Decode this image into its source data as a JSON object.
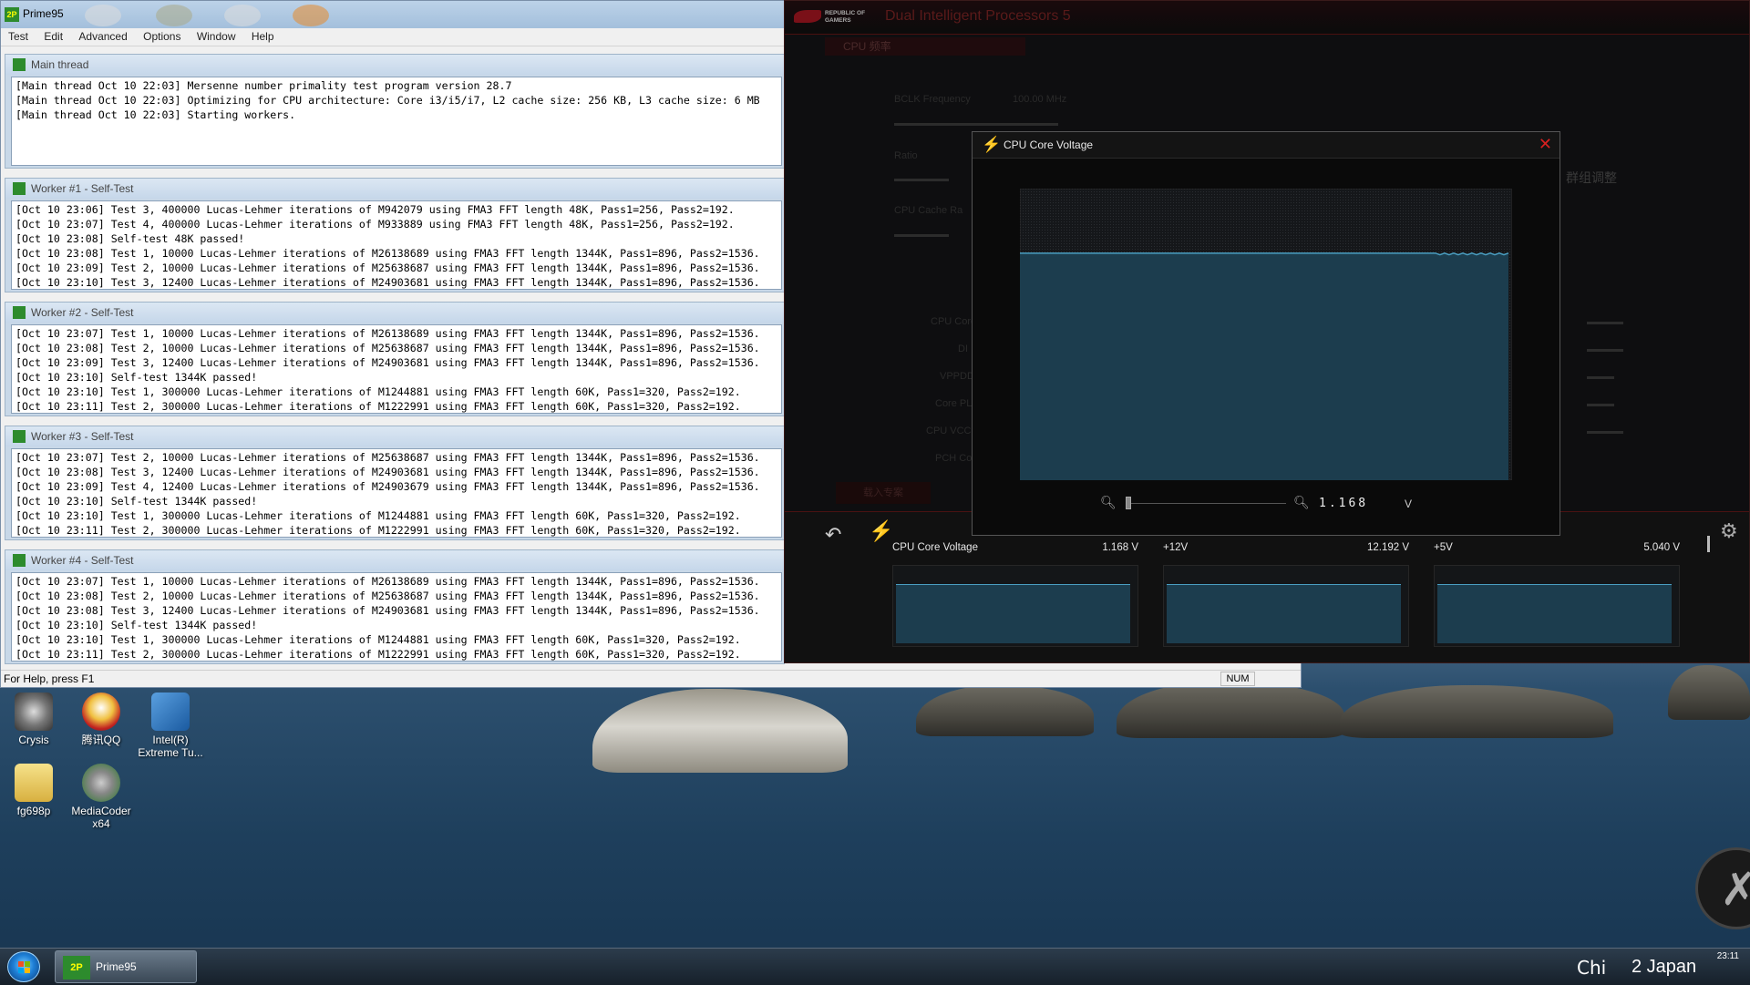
{
  "prime95": {
    "title": "Prime95",
    "menu": [
      "Test",
      "Edit",
      "Advanced",
      "Options",
      "Window",
      "Help"
    ],
    "windows": [
      {
        "title": "Main thread",
        "lines": [
          "[Main thread Oct 10 22:03] Mersenne number primality test program version 28.7",
          "[Main thread Oct 10 22:03] Optimizing for CPU architecture: Core i3/i5/i7, L2 cache size: 256 KB, L3 cache size: 6 MB",
          "[Main thread Oct 10 22:03] Starting workers."
        ]
      },
      {
        "title": "Worker #1 - Self-Test",
        "lines": [
          "[Oct 10 23:06] Test 3, 400000 Lucas-Lehmer iterations of M942079 using FMA3 FFT length 48K, Pass1=256, Pass2=192.",
          "[Oct 10 23:07] Test 4, 400000 Lucas-Lehmer iterations of M933889 using FMA3 FFT length 48K, Pass1=256, Pass2=192.",
          "[Oct 10 23:08] Self-test 48K passed!",
          "[Oct 10 23:08] Test 1, 10000 Lucas-Lehmer iterations of M26138689 using FMA3 FFT length 1344K, Pass1=896, Pass2=1536.",
          "[Oct 10 23:09] Test 2, 10000 Lucas-Lehmer iterations of M25638687 using FMA3 FFT length 1344K, Pass1=896, Pass2=1536.",
          "[Oct 10 23:10] Test 3, 12400 Lucas-Lehmer iterations of M24903681 using FMA3 FFT length 1344K, Pass1=896, Pass2=1536."
        ]
      },
      {
        "title": "Worker #2 - Self-Test",
        "lines": [
          "[Oct 10 23:07] Test 1, 10000 Lucas-Lehmer iterations of M26138689 using FMA3 FFT length 1344K, Pass1=896, Pass2=1536.",
          "[Oct 10 23:08] Test 2, 10000 Lucas-Lehmer iterations of M25638687 using FMA3 FFT length 1344K, Pass1=896, Pass2=1536.",
          "[Oct 10 23:09] Test 3, 12400 Lucas-Lehmer iterations of M24903681 using FMA3 FFT length 1344K, Pass1=896, Pass2=1536.",
          "[Oct 10 23:10] Self-test 1344K passed!",
          "[Oct 10 23:10] Test 1, 300000 Lucas-Lehmer iterations of M1244881 using FMA3 FFT length 60K, Pass1=320, Pass2=192.",
          "[Oct 10 23:11] Test 2, 300000 Lucas-Lehmer iterations of M1222991 using FMA3 FFT length 60K, Pass1=320, Pass2=192."
        ]
      },
      {
        "title": "Worker #3 - Self-Test",
        "lines": [
          "[Oct 10 23:07] Test 2, 10000 Lucas-Lehmer iterations of M25638687 using FMA3 FFT length 1344K, Pass1=896, Pass2=1536.",
          "[Oct 10 23:08] Test 3, 12400 Lucas-Lehmer iterations of M24903681 using FMA3 FFT length 1344K, Pass1=896, Pass2=1536.",
          "[Oct 10 23:09] Test 4, 12400 Lucas-Lehmer iterations of M24903679 using FMA3 FFT length 1344K, Pass1=896, Pass2=1536.",
          "[Oct 10 23:10] Self-test 1344K passed!",
          "[Oct 10 23:10] Test 1, 300000 Lucas-Lehmer iterations of M1244881 using FMA3 FFT length 60K, Pass1=320, Pass2=192.",
          "[Oct 10 23:11] Test 2, 300000 Lucas-Lehmer iterations of M1222991 using FMA3 FFT length 60K, Pass1=320, Pass2=192."
        ]
      },
      {
        "title": "Worker #4 - Self-Test",
        "lines": [
          "[Oct 10 23:07] Test 1, 10000 Lucas-Lehmer iterations of M26138689 using FMA3 FFT length 1344K, Pass1=896, Pass2=1536.",
          "[Oct 10 23:08] Test 2, 10000 Lucas-Lehmer iterations of M25638687 using FMA3 FFT length 1344K, Pass1=896, Pass2=1536.",
          "[Oct 10 23:08] Test 3, 12400 Lucas-Lehmer iterations of M24903681 using FMA3 FFT length 1344K, Pass1=896, Pass2=1536.",
          "[Oct 10 23:10] Self-test 1344K passed!",
          "[Oct 10 23:10] Test 1, 300000 Lucas-Lehmer iterations of M1244881 using FMA3 FFT length 60K, Pass1=320, Pass2=192.",
          "[Oct 10 23:11] Test 2, 300000 Lucas-Lehmer iterations of M1222991 using FMA3 FFT length 60K, Pass1=320, Pass2=192."
        ]
      }
    ],
    "status_help": "For Help, press F1",
    "status_num": "NUM"
  },
  "aisuite": {
    "title": "Dual Intelligent Processors 5",
    "logo_text": "REPUBLIC OF GAMERS",
    "subtab": "CPU 频率",
    "dim_labels": {
      "bclk": "BCLK Frequency",
      "bclk_value": "100.00 MHz",
      "ratio": "Ratio",
      "cache": "CPU Cache Ra",
      "cjk_label": "群组调整",
      "rows": [
        "CPU Core",
        "DI",
        "VPPDD",
        "Core PL",
        "CPU VCCI",
        "PCH Cor"
      ],
      "button": "载入专案"
    },
    "monitors": [
      {
        "label": "CPU Core Voltage",
        "value": "1.168 V"
      },
      {
        "label": "+12V",
        "value": "12.192 V"
      },
      {
        "label": "+5V",
        "value": "5.040 V"
      }
    ],
    "popup": {
      "title": "CPU Core Voltage",
      "readout": "1.168",
      "unit": "V"
    },
    "colors": {
      "chart_line": "#4a9fc2",
      "chart_fill": "#1c3d4e",
      "close_x": "#d92020"
    }
  },
  "desktop": {
    "icons": [
      {
        "label": "Crysis"
      },
      {
        "label": "腾讯QQ"
      },
      {
        "label": "Intel(R) Extreme Tu..."
      },
      {
        "label": "fg698p"
      },
      {
        "label": "MediaCoder x64"
      }
    ]
  },
  "taskbar": {
    "items": [
      {
        "label": "Prime95"
      }
    ],
    "ime": "Chi",
    "clock_time": "23:11",
    "tray_text": "2 Japan"
  },
  "chart_data": {
    "type": "area",
    "title": "CPU Core Voltage",
    "series": [
      {
        "name": "CPU Core Voltage",
        "values": [
          1.168,
          1.168,
          1.168,
          1.168,
          1.168,
          1.168,
          1.168,
          1.168,
          1.168,
          1.168,
          1.168,
          1.168,
          1.168,
          1.168,
          1.168,
          1.168,
          1.168,
          1.168,
          1.168,
          1.168,
          1.168,
          1.168,
          1.168,
          1.168,
          1.168,
          1.168,
          1.168,
          1.168,
          1.168,
          1.168,
          1.168,
          1.168,
          1.168,
          1.168,
          1.168,
          1.168,
          1.168,
          1.168,
          1.168,
          1.168,
          1.168,
          1.168,
          1.168,
          1.168,
          1.168,
          1.168,
          1.168,
          1.168,
          1.168,
          1.168,
          1.168,
          1.168,
          1.168,
          1.168,
          1.168,
          1.168,
          1.168,
          1.168,
          1.168,
          1.168,
          1.168,
          1.168,
          1.168,
          1.168,
          1.168,
          1.168,
          1.168,
          1.168,
          1.168,
          1.168,
          1.168,
          1.168,
          1.168,
          1.168,
          1.168,
          1.168,
          1.168,
          1.168,
          1.168,
          1.168,
          1.168,
          1.168,
          1.168,
          1.168,
          1.168,
          1.168,
          1.168,
          1.168,
          1.168,
          1.168,
          1.168,
          1.168,
          1.16,
          1.168,
          1.16,
          1.168,
          1.16,
          1.168,
          1.16,
          1.168,
          1.16,
          1.168,
          1.16,
          1.168,
          1.16,
          1.168,
          1.16,
          1.168
        ]
      }
    ],
    "ylim": [
      0,
      1.5
    ],
    "grid": true
  }
}
